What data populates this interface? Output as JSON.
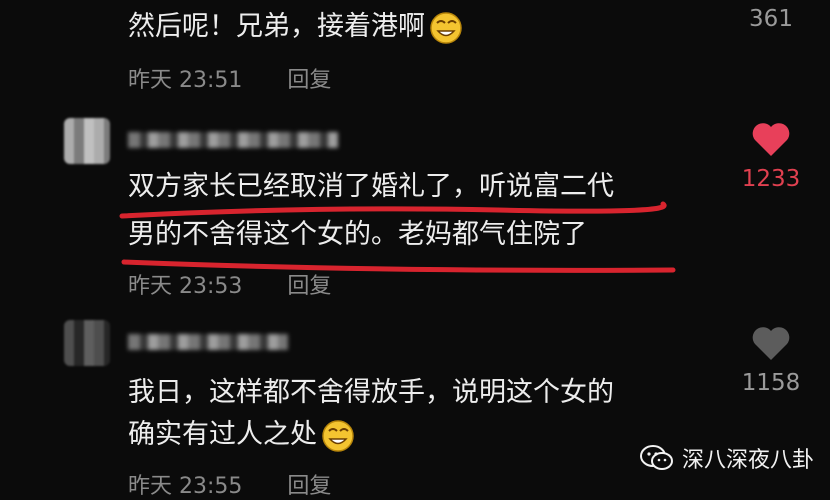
{
  "comments": [
    {
      "text": "然后呢！兄弟，接着港啊",
      "time": "昨天 23:51",
      "reply_label": "回复",
      "likes": "361",
      "liked": false
    },
    {
      "text_line1": "双方家长已经取消了婚礼了，听说富二代",
      "text_line2": "男的不舍得这个女的。老妈都气住院了",
      "time": "昨天 23:53",
      "reply_label": "回复",
      "likes": "1233",
      "liked": true
    },
    {
      "text_line1": "我日，这样都不舍得放手，说明这个女的",
      "text_line2": "确实有过人之处",
      "time": "昨天 23:55",
      "reply_label": "回复",
      "likes": "1158",
      "liked": false
    }
  ],
  "watermark": {
    "label": "深八深夜八卦",
    "icon": "wechat-icon"
  },
  "colors": {
    "background": "#0b0b0b",
    "heart_liked": "#e8405a",
    "underline": "#d8242e"
  }
}
